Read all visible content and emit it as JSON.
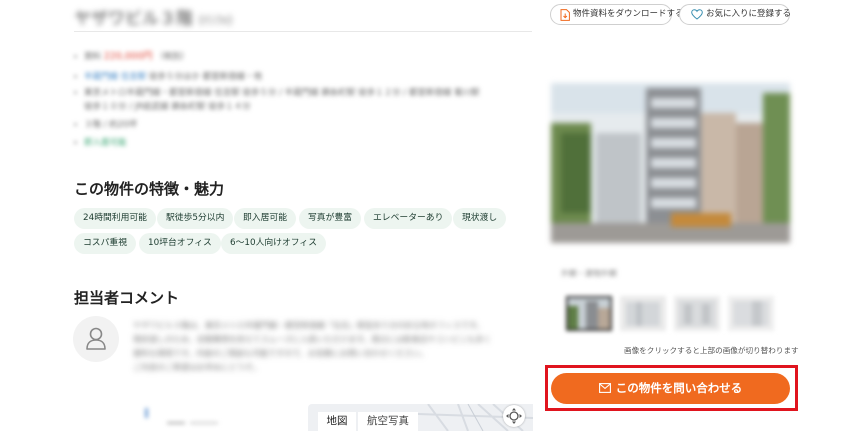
{
  "header": {
    "property_title": "ヤザワビル３階",
    "property_title_sub": "(ｲﾝﾌｫ)"
  },
  "info": {
    "price_label": "賃料",
    "price_value": "220,000円",
    "price_suffix": "（税別）",
    "access_line_blue": "半蔵門線 住吉駅",
    "access_line_rest": "徒歩５分ほか 都営新宿線・他",
    "detail_line_1": "東京メトロ半蔵門線・都営新宿線 住吉駅 徒歩５分 / 半蔵門線 錦糸町駅 徒歩１２分 / 都営新宿線 菊川駅",
    "detail_line_2": "徒歩１０分 / JR総武線 錦糸町駅 徒歩１４分",
    "floor_line": "３階 / 約20坪",
    "status_green": "即入居可能"
  },
  "features": {
    "heading": "この物件の特徴・魅力",
    "tags": [
      "24時間利用可能",
      "駅徒歩5分以内",
      "即入居可能",
      "写真が豊富",
      "エレベーターあり",
      "現状渡し",
      "コスパ重視",
      "10坪台オフィス",
      "6〜10人向けオフィス"
    ]
  },
  "agent": {
    "heading": "担当者コメント",
    "comment_line_1": "ヤザワビル３階は、東京メトロ半蔵門線・都営新宿線「住吉」駅徒歩５分の好立地オフィスです。",
    "comment_line_2": "現状渡しのため、初期費用を抑えてスムーズに入居いただけます。周辺には飲食店やコンビニも多く",
    "comment_line_3": "便利な環境です。内装のご相談も可能ですので、お気軽にお問い合わせください。",
    "comment_line_4": "ご内見のご希望はお早めにどうぞ。"
  },
  "map": {
    "tab_map": "地図",
    "tab_aerial": "航空写真"
  },
  "actions": {
    "download_label": "物件資料をダウンロードする",
    "favorite_label": "お気に入りに登録する",
    "inquiry_label": "この物件を問い合わせる"
  },
  "gallery": {
    "caption": "外観・建物外観",
    "thumb_hint": "画像をクリックすると上部の画像が切り替わります"
  },
  "colors": {
    "accent_orange": "#f06a1f",
    "highlight_red": "#e0141e",
    "tag_background": "#edf5f0"
  },
  "icons": {
    "download": "document-download-icon",
    "favorite": "heart-icon",
    "inquiry": "mail-icon",
    "avatar": "person-icon",
    "fullscreen": "fullscreen-icon"
  }
}
